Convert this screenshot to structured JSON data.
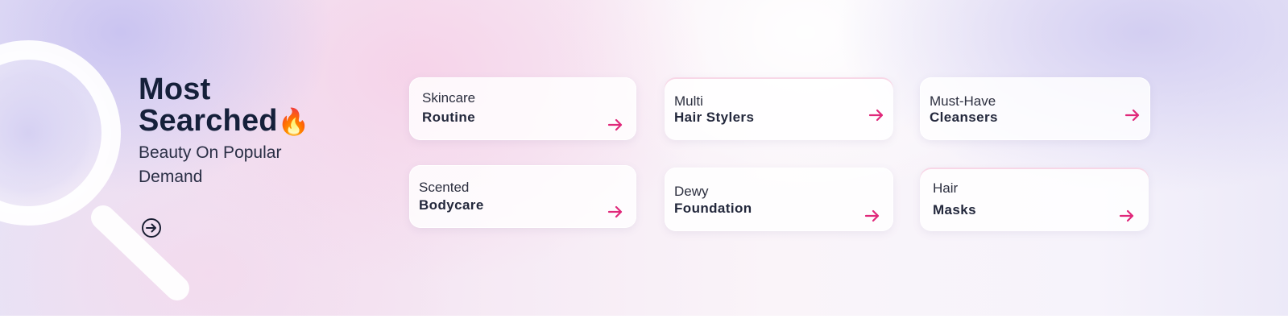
{
  "headline": {
    "title_line1": "Most",
    "title_line2": "Searched",
    "title_emoji": "🔥",
    "subtitle": "Beauty On Popular Demand"
  },
  "icons": {
    "background": "magnifier-icon",
    "cta": "arrow-circle-right-icon",
    "card_arrow": "arrow-right-icon",
    "title_emoji": "fire-icon"
  },
  "colors": {
    "title": "#15203a",
    "accent_arrow": "#e0287a",
    "flame": "#f0781e"
  },
  "cards": [
    {
      "line1": "Skincare",
      "line2": "Routine"
    },
    {
      "line1": "Multi",
      "line2": "Hair Stylers"
    },
    {
      "line1": "Must-Have",
      "line2": "Cleansers"
    },
    {
      "line1": "Scented",
      "line2": "Bodycare"
    },
    {
      "line1": "Dewy",
      "line2": "Foundation"
    },
    {
      "line1": "Hair",
      "line2": "Masks"
    }
  ]
}
